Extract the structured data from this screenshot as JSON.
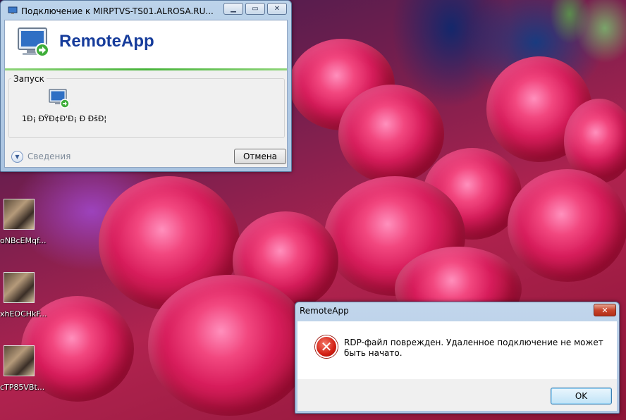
{
  "remote_window": {
    "title": "Подключение к MIRPTVS-TS01.ALROSA.RU...",
    "brand": "RemoteApp",
    "group_label": "Запуск",
    "app_label": "1Đ¡ ĐŸĐ¢Đ'Đ¡ Đ ĐšĐ¦",
    "details_label": "Сведения",
    "cancel_label": "Отмена",
    "minimize_icon": "minimize-icon",
    "maximize_icon": "maximize-icon",
    "close_icon": "close-icon"
  },
  "error_dialog": {
    "title": "RemoteApp",
    "message": "RDP-файл поврежден. Удаленное подключение не может быть начато.",
    "ok_label": "OK",
    "icon": "error-icon",
    "close_icon": "close-icon"
  },
  "desktop": {
    "icons": [
      {
        "label": "oNBcEMqf..."
      },
      {
        "label": "xhEOCHkF..."
      },
      {
        "label": "cTP85VBt..."
      }
    ]
  },
  "colors": {
    "brand_blue": "#163c9b",
    "progress_green": "#47b33a",
    "error_red": "#d21e12"
  }
}
